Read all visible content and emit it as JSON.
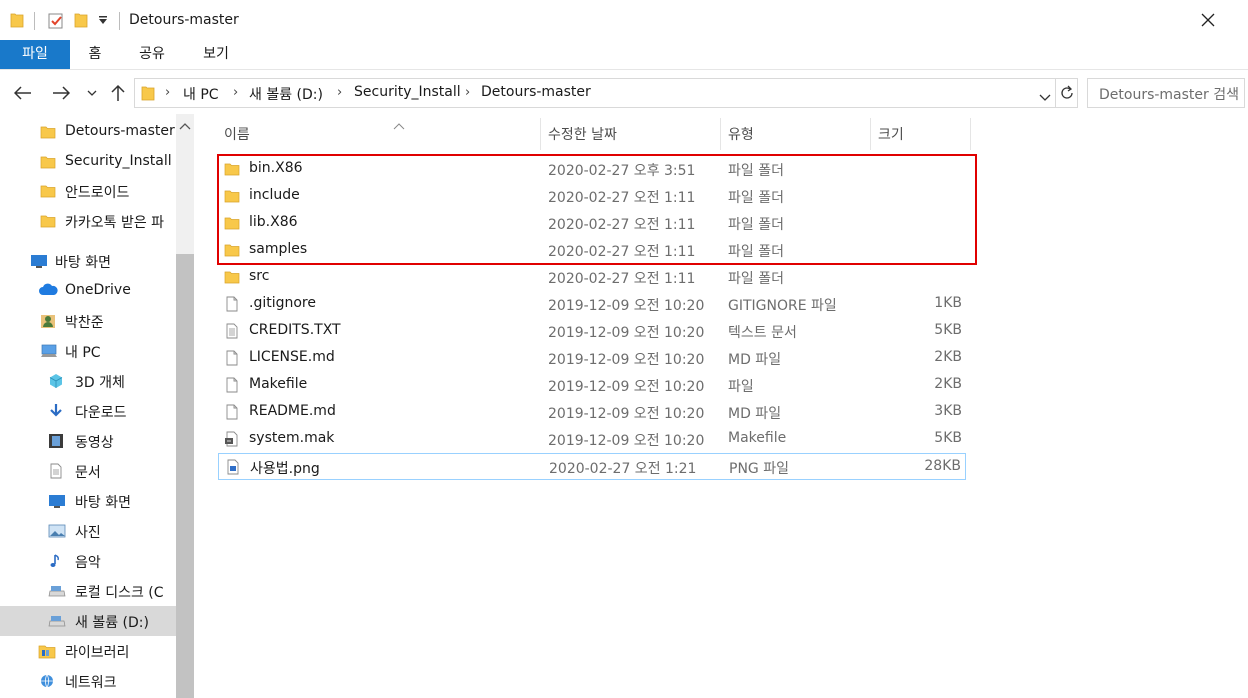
{
  "window": {
    "title": "Detours-master"
  },
  "ribbon": {
    "tabs": [
      "파일",
      "홈",
      "공유",
      "보기"
    ]
  },
  "address": {
    "crumbs": [
      "내 PC",
      "새 볼륨 (D:)",
      "Security_Install",
      "Detours-master"
    ],
    "search_placeholder": "Detours-master 검색"
  },
  "sidebar": {
    "items": [
      {
        "label": "Detours-master",
        "icon": "folder-icon"
      },
      {
        "label": "Security_Install",
        "icon": "folder-icon"
      },
      {
        "label": "안드로이드",
        "icon": "folder-icon"
      },
      {
        "label": "카카오톡 받은 파",
        "icon": "folder-icon"
      },
      {
        "label": "바탕 화면",
        "icon": "desktop-icon"
      },
      {
        "label": "OneDrive",
        "icon": "onedrive-icon"
      },
      {
        "label": "박찬준",
        "icon": "user-icon"
      },
      {
        "label": "내 PC",
        "icon": "pc-icon"
      },
      {
        "label": "3D 개체",
        "icon": "3d-objects-icon"
      },
      {
        "label": "다운로드",
        "icon": "download-icon"
      },
      {
        "label": "동영상",
        "icon": "video-icon"
      },
      {
        "label": "문서",
        "icon": "document-icon"
      },
      {
        "label": "바탕 화면",
        "icon": "desktop-icon"
      },
      {
        "label": "사진",
        "icon": "pictures-icon"
      },
      {
        "label": "음악",
        "icon": "music-icon"
      },
      {
        "label": "로컬 디스크 (C",
        "icon": "drive-icon"
      },
      {
        "label": "새 볼륨 (D:)",
        "icon": "drive-icon"
      },
      {
        "label": "라이브러리",
        "icon": "library-icon"
      },
      {
        "label": "네트워크",
        "icon": "network-icon"
      }
    ]
  },
  "columns": {
    "name": "이름",
    "date": "수정한 날짜",
    "type": "유형",
    "size": "크기"
  },
  "files": [
    {
      "name": "bin.X86",
      "date": "2020-02-27 오후 3:51",
      "type": "파일 폴더",
      "size": "",
      "icon": "folder-icon"
    },
    {
      "name": "include",
      "date": "2020-02-27 오전 1:11",
      "type": "파일 폴더",
      "size": "",
      "icon": "folder-icon"
    },
    {
      "name": "lib.X86",
      "date": "2020-02-27 오전 1:11",
      "type": "파일 폴더",
      "size": "",
      "icon": "folder-icon"
    },
    {
      "name": "samples",
      "date": "2020-02-27 오전 1:11",
      "type": "파일 폴더",
      "size": "",
      "icon": "folder-icon"
    },
    {
      "name": "src",
      "date": "2020-02-27 오전 1:11",
      "type": "파일 폴더",
      "size": "",
      "icon": "folder-icon"
    },
    {
      "name": ".gitignore",
      "date": "2019-12-09 오전 10:20",
      "type": "GITIGNORE 파일",
      "size": "1KB",
      "icon": "file-icon"
    },
    {
      "name": "CREDITS.TXT",
      "date": "2019-12-09 오전 10:20",
      "type": "텍스트 문서",
      "size": "5KB",
      "icon": "text-file-icon"
    },
    {
      "name": "LICENSE.md",
      "date": "2019-12-09 오전 10:20",
      "type": "MD 파일",
      "size": "2KB",
      "icon": "file-icon"
    },
    {
      "name": "Makefile",
      "date": "2019-12-09 오전 10:20",
      "type": "파일",
      "size": "2KB",
      "icon": "file-icon"
    },
    {
      "name": "README.md",
      "date": "2019-12-09 오전 10:20",
      "type": "MD 파일",
      "size": "3KB",
      "icon": "file-icon"
    },
    {
      "name": "system.mak",
      "date": "2019-12-09 오전 10:20",
      "type": "Makefile",
      "size": "5KB",
      "icon": "makefile-icon"
    },
    {
      "name": "사용법.png",
      "date": "2020-02-27 오전 1:21",
      "type": "PNG 파일",
      "size": "28KB",
      "icon": "image-file-icon"
    }
  ],
  "colors": {
    "accent": "#1979ca",
    "highlight": "#e00000",
    "folder": "#f8c84a"
  }
}
